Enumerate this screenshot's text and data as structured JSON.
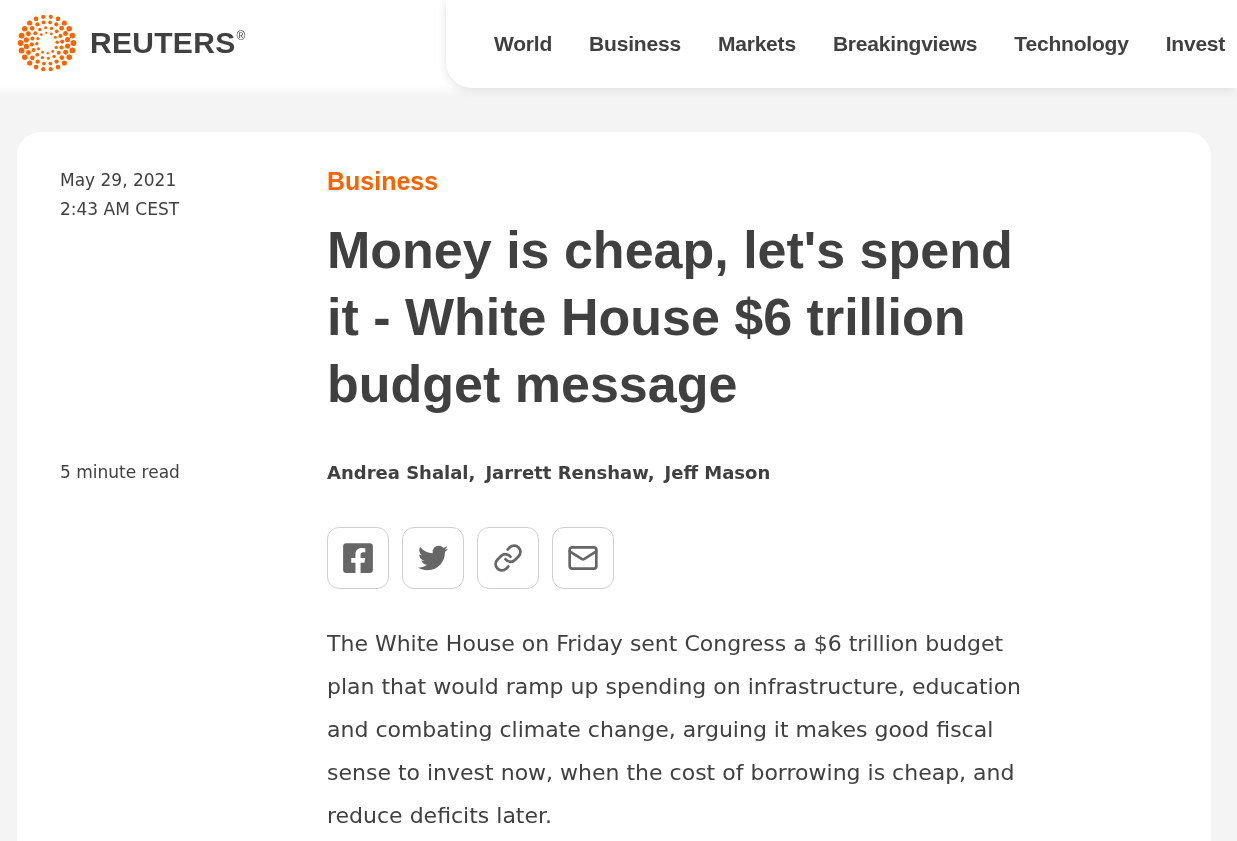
{
  "header": {
    "logo": {
      "wordmark": "REUTERS",
      "registered": "®"
    },
    "nav": [
      {
        "label": "World"
      },
      {
        "label": "Business"
      },
      {
        "label": "Markets"
      },
      {
        "label": "Breakingviews"
      },
      {
        "label": "Technology"
      },
      {
        "label": "Invest"
      }
    ]
  },
  "article": {
    "date": "May 29, 2021",
    "time": "2:43 AM CEST",
    "read_time": "5 minute read",
    "category": "Business",
    "headline": "Money is cheap, let's spend it - White House $6 trillion budget message",
    "authors": [
      "Andrea Shalal,",
      "Jarrett Renshaw,",
      "Jeff Mason"
    ],
    "share_buttons": [
      {
        "kind": "facebook"
      },
      {
        "kind": "twitter"
      },
      {
        "kind": "link"
      },
      {
        "kind": "email"
      }
    ],
    "body": "The White House on Friday sent Congress a $6 trillion budget plan that would ramp up spending on infrastructure, education and combating climate change, arguing it makes good fiscal sense to invest now, when the cost of borrowing is cheap, and reduce deficits later."
  }
}
